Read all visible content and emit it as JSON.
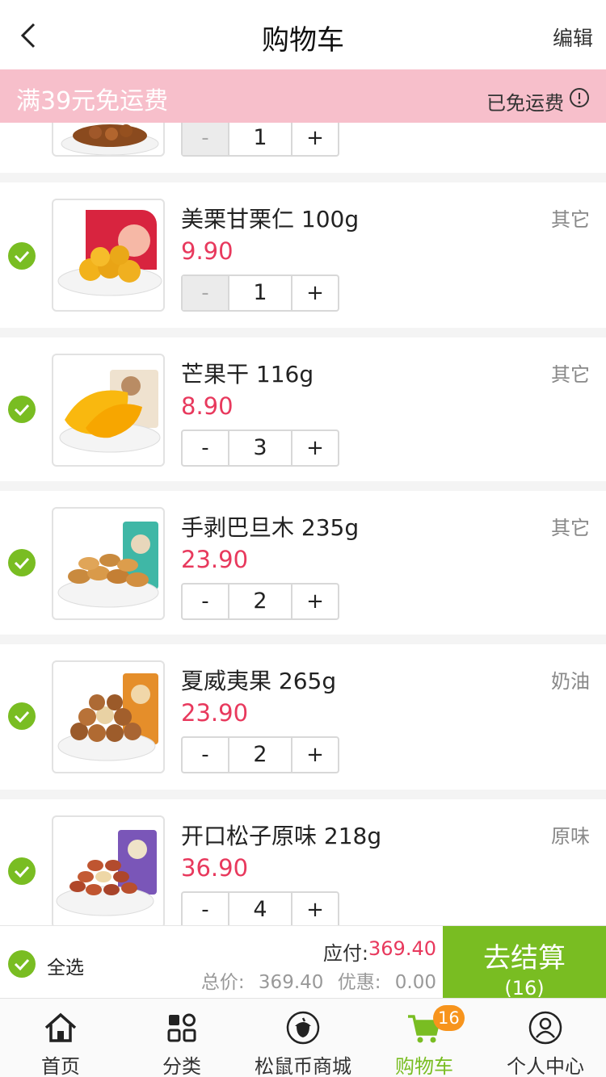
{
  "header": {
    "title": "购物车",
    "edit_label": "编辑"
  },
  "promo": {
    "left_text": "满39元免运费",
    "right_text": "已免运费"
  },
  "colors": {
    "accent_green": "#79bd22",
    "price_red": "#e8395d",
    "promo_pink": "#f7bfcb",
    "badge_orange": "#f7941d"
  },
  "partial_item": {
    "quantity": "1",
    "minus": "-",
    "plus": "+"
  },
  "items": [
    {
      "name": "美栗甘栗仁 100g",
      "price": "9.90",
      "spec": "其它",
      "quantity": "1",
      "minus": "-",
      "plus": "+"
    },
    {
      "name": "芒果干 116g",
      "price": "8.90",
      "spec": "其它",
      "quantity": "3",
      "minus": "-",
      "plus": "+"
    },
    {
      "name": "手剥巴旦木 235g",
      "price": "23.90",
      "spec": "其它",
      "quantity": "2",
      "minus": "-",
      "plus": "+"
    },
    {
      "name": "夏威夷果 265g",
      "price": "23.90",
      "spec": "奶油",
      "quantity": "2",
      "minus": "-",
      "plus": "+"
    },
    {
      "name": "开口松子原味 218g",
      "price": "36.90",
      "spec": "原味",
      "quantity": "4",
      "minus": "-",
      "plus": "+"
    }
  ],
  "checkout": {
    "select_all": "全选",
    "payable_label": "应付:",
    "payable_amount": "369.40",
    "total_label": "总价:",
    "total_amount": "369.40",
    "discount_label": "优惠:",
    "discount_amount": "0.00",
    "go_label": "去结算",
    "go_count": "(16)"
  },
  "tabs": [
    {
      "label": "首页",
      "icon": "home-icon"
    },
    {
      "label": "分类",
      "icon": "category-icon"
    },
    {
      "label": "松鼠币商城",
      "icon": "acorn-icon"
    },
    {
      "label": "购物车",
      "icon": "cart-icon",
      "badge": "16",
      "active": true
    },
    {
      "label": "个人中心",
      "icon": "user-icon"
    }
  ]
}
